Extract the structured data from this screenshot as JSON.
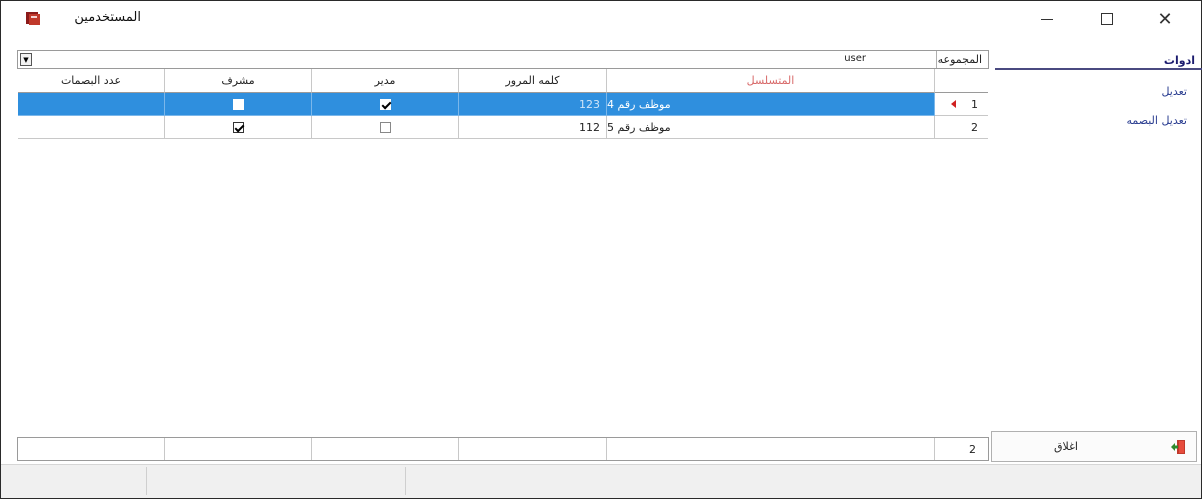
{
  "window": {
    "title": "المستخدمين",
    "minimize_icon": "minimize-icon",
    "maximize_icon": "maximize-icon",
    "close_icon": "close-icon"
  },
  "side_panel": {
    "tab_label": "ادوات",
    "links": [
      "تعديل",
      "تعديل البصمه"
    ]
  },
  "group_filter": {
    "label": "المجموعه",
    "value": "user"
  },
  "grid": {
    "columns": {
      "number": "",
      "serial": "المتسلسل",
      "password": "كلمه المرور",
      "manager": "مدير",
      "supervisor": "مشرف",
      "fingerprint_count": "عدد البصمات"
    },
    "rows": [
      {
        "number": "1",
        "serial": "موظف رقم 4",
        "password": "123",
        "manager": true,
        "supervisor": false,
        "fingerprint_count": "",
        "selected": true
      },
      {
        "number": "2",
        "serial": "موظف رقم 5",
        "password": "112",
        "manager": false,
        "supervisor": true,
        "fingerprint_count": "",
        "selected": false
      }
    ]
  },
  "footer": {
    "record_count": "2"
  },
  "close_button": {
    "label": "اغلاق",
    "icon": "exit-door-icon"
  },
  "colors": {
    "selection": "#2f8fde",
    "serial_header": "#d86a6a",
    "tab_accent": "#1b1b6e",
    "row_indicator": "#d02020"
  }
}
